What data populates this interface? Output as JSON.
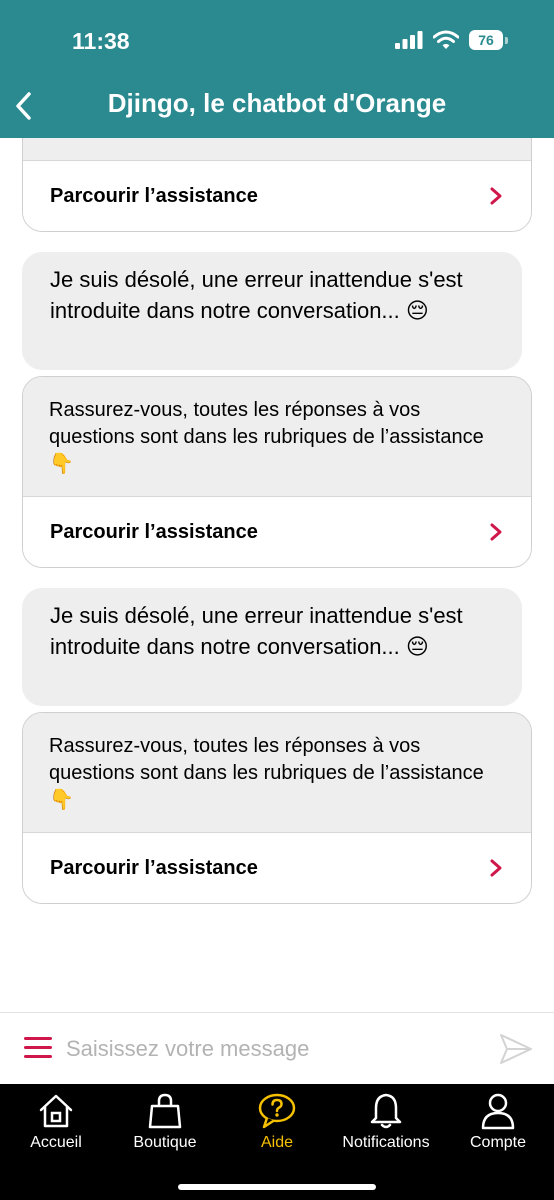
{
  "status": {
    "time": "11:38",
    "battery": "76"
  },
  "header": {
    "title": "Djingo, le chatbot d'Orange"
  },
  "chat": {
    "top_card": {
      "action_label": "Parcourir l’assistance"
    },
    "messages": [
      {
        "error_text": "Je suis désolé, une erreur inattendue s'est introduite dans notre conversation... 😔",
        "help_text": "Rassurez-vous, toutes les réponses à vos questions sont dans les rubriques de l’assistance 👇",
        "action_label": "Parcourir l’assistance"
      },
      {
        "error_text": "Je suis désolé, une erreur inattendue s'est introduite dans notre conversation... 😔",
        "help_text": "Rassurez-vous, toutes les réponses à vos questions sont dans les rubriques de l’assistance 👇",
        "action_label": "Parcourir l’assistance"
      }
    ]
  },
  "input": {
    "placeholder": "Saisissez votre message",
    "value": ""
  },
  "tabs": [
    {
      "label": "Accueil",
      "icon": "home-icon",
      "active": false
    },
    {
      "label": "Boutique",
      "icon": "shopping-bag-icon",
      "active": false
    },
    {
      "label": "Aide",
      "icon": "help-bubble-icon",
      "active": true
    },
    {
      "label": "Notifications",
      "icon": "bell-icon",
      "active": false
    },
    {
      "label": "Compte",
      "icon": "user-icon",
      "active": false
    }
  ],
  "colors": {
    "header": "#2b8a8f",
    "accent": "#d0174b",
    "active_tab": "#f5c000",
    "bubble": "#eeeeee"
  }
}
